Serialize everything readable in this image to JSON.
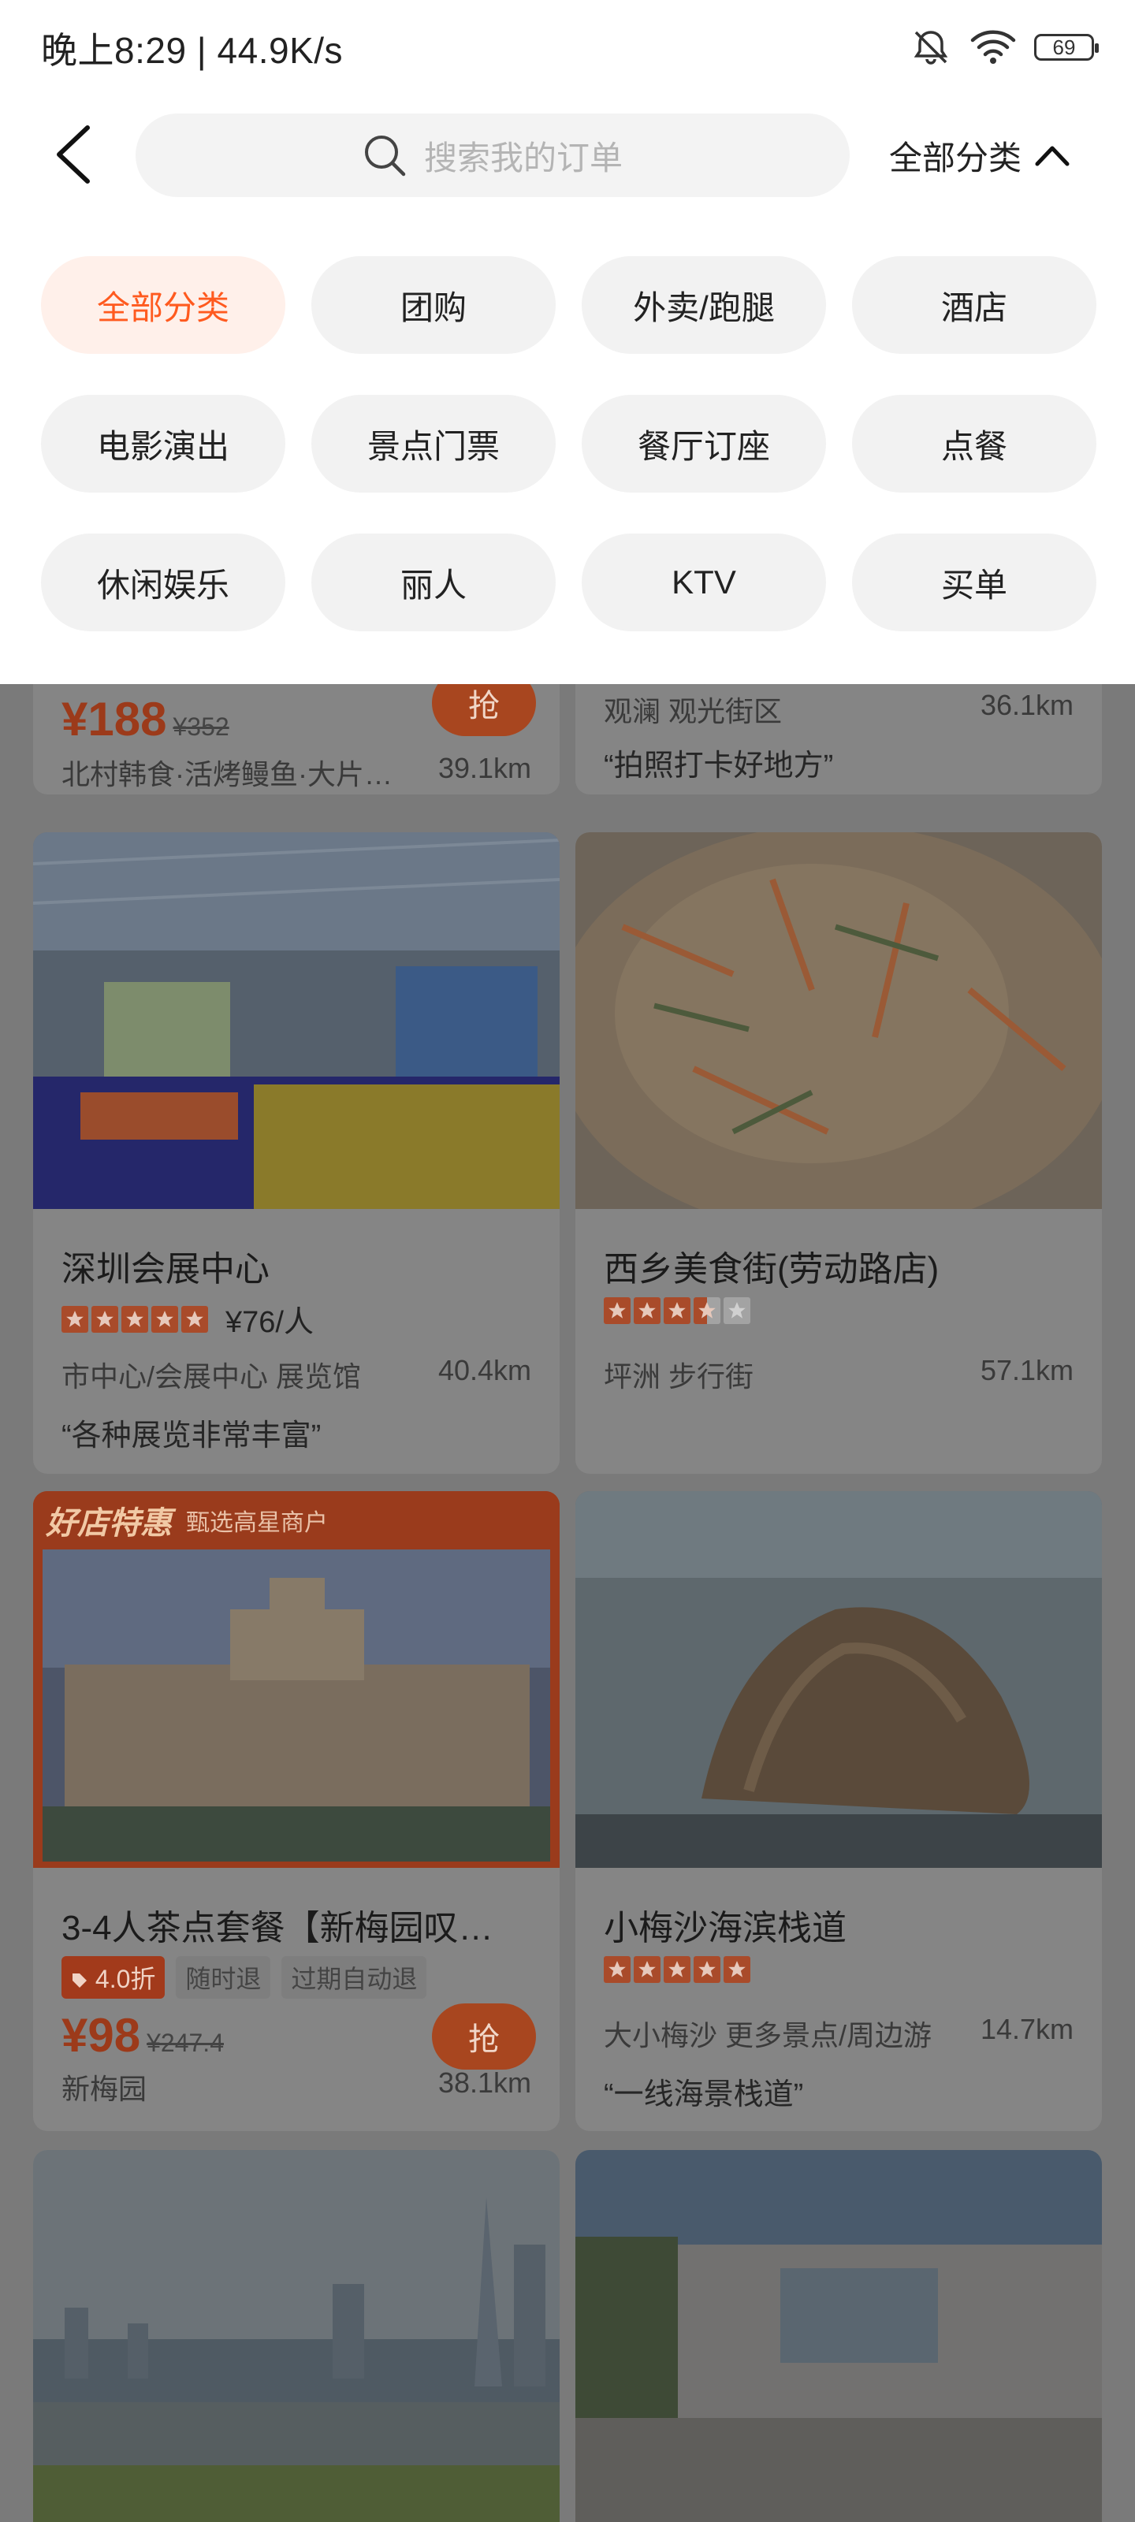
{
  "status_bar": {
    "time_speed": "晚上8:29 | 44.9K/s",
    "battery": "69"
  },
  "header": {
    "search_placeholder": "搜索我的订单",
    "category_toggle_label": "全部分类"
  },
  "categories": [
    {
      "label": "全部分类",
      "active": true
    },
    {
      "label": "团购"
    },
    {
      "label": "外卖/跑腿"
    },
    {
      "label": "酒店"
    },
    {
      "label": "电影演出"
    },
    {
      "label": "景点门票"
    },
    {
      "label": "餐厅订座"
    },
    {
      "label": "点餐"
    },
    {
      "label": "休闲娱乐"
    },
    {
      "label": "丽人"
    },
    {
      "label": "KTV"
    },
    {
      "label": "买单"
    }
  ],
  "feed": {
    "top_left": {
      "price": "¥188",
      "original_price": "¥352",
      "name": "北村韩食·活烤鳗鱼·大片…",
      "distance": "39.1km",
      "button": "抢"
    },
    "top_right": {
      "area": "观澜 观光街区",
      "distance": "36.1km",
      "quote": "“拍照打卡好地方”"
    },
    "card1": {
      "title": "深圳会展中心",
      "rating": 5,
      "price_per": "¥76/人",
      "area": "市中心/会展中心 展览馆",
      "distance": "40.4km",
      "quote": "“各种展览非常丰富”"
    },
    "card2": {
      "title": "西乡美食街(劳动路店)",
      "rating": 3.5,
      "area": "坪洲 步行街",
      "distance": "57.1km"
    },
    "card3": {
      "banner_title": "好店特惠",
      "banner_sub": "甄选高星商户",
      "title": "3-4人茶点套餐【新梅园叹…",
      "discount_tag": "4.0折",
      "tag1": "随时退",
      "tag2": "过期自动退",
      "price": "¥98",
      "original_price": "¥247.4",
      "shop": "新梅园",
      "distance": "38.1km",
      "button": "抢"
    },
    "card4": {
      "title": "小梅沙海滨栈道",
      "rating": 5,
      "area": "大小梅沙 更多景点/周边游",
      "distance": "14.7km",
      "quote": "“一线海景栈道”"
    }
  },
  "colors": {
    "accent": "#ff5a1f",
    "chip_active_bg": "#fff0ea",
    "chip_bg": "#f2f2f2",
    "overlay": "#7a7a7a"
  }
}
